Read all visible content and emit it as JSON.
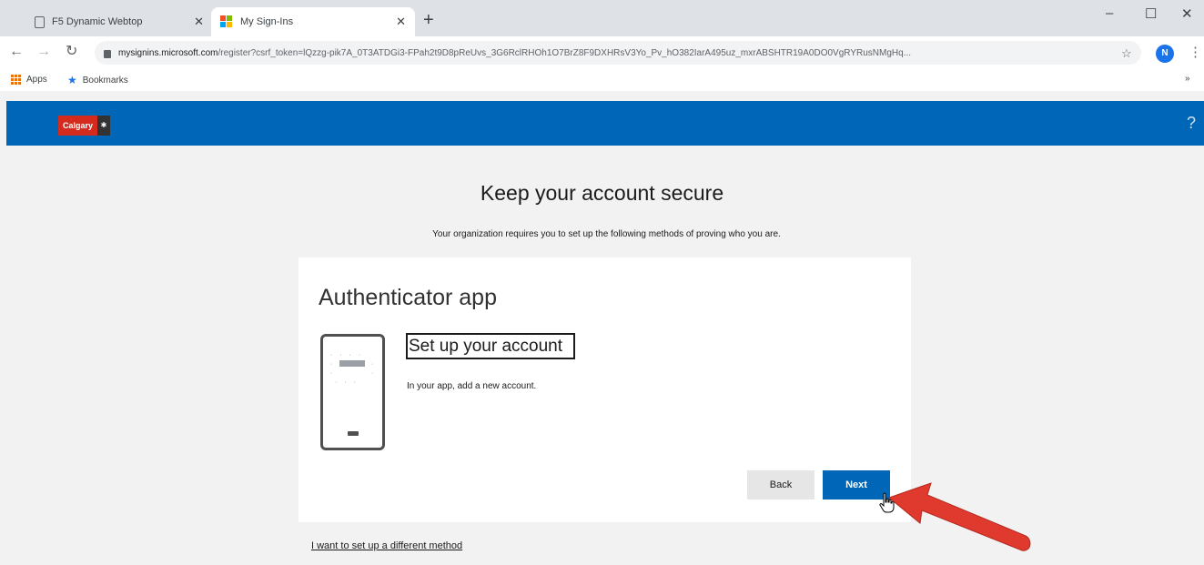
{
  "browser": {
    "tabs": [
      {
        "title": "F5 Dynamic Webtop",
        "active": false,
        "icon": "document-icon"
      },
      {
        "title": "My Sign-Ins",
        "active": true,
        "icon": "microsoft-icon"
      }
    ],
    "new_tab_symbol": "+",
    "window_controls": {
      "minimize": "–",
      "maximize": "☐",
      "close": "✕"
    },
    "url_host": "mysignins.microsoft.com",
    "url_path": "/register?csrf_token=lQzzg-pik7A_0T3ATDGi3-FPah2t9D8pReUvs_3G6RclRHOh1O7BrZ8F9DXHRsV3Yo_Pv_hO382IarA495uz_mxrABSHTR19A0DO0VgRYRusNMgHq...",
    "profile_initial": "N",
    "bookmarks": {
      "apps_label": "Apps",
      "bookmarks_label": "Bookmarks",
      "overflow": "»"
    }
  },
  "app": {
    "logo_text": "Calgary",
    "help_symbol": "?",
    "colors": {
      "header": "#0067b8",
      "primary_button": "#0067b8",
      "logo_red": "#d52b1e",
      "annotation_arrow": "#e03a2e"
    }
  },
  "page": {
    "title": "Keep your account secure",
    "subtitle": "Your organization requires you to set up the following methods of proving who you are."
  },
  "card": {
    "title": "Authenticator app",
    "step_title": "Set up your account",
    "step_description": "In your app, add a new account.",
    "back_label": "Back",
    "next_label": "Next",
    "different_method_link": "I want to set up a different method"
  }
}
